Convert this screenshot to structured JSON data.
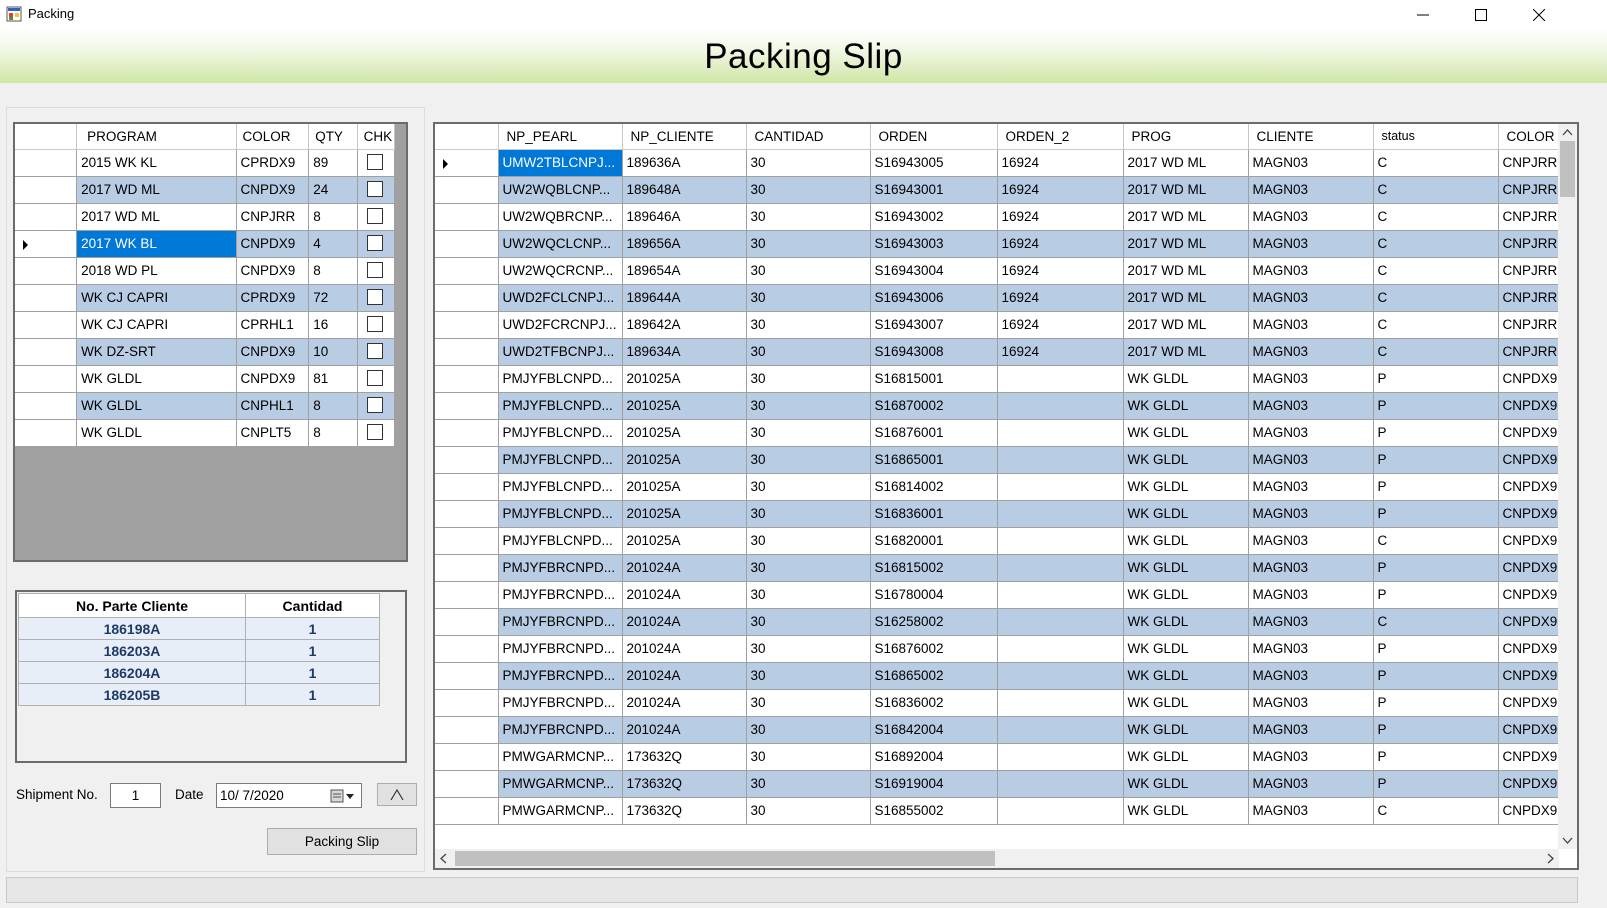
{
  "window": {
    "title": "Packing"
  },
  "banner": {
    "title": "Packing Slip"
  },
  "program_grid": {
    "columns": [
      "PROGRAM",
      "COLOR",
      "QTY",
      "CHK"
    ],
    "rows": [
      {
        "program": "2015 WK KL",
        "color": "CPRDX9",
        "qty": "89"
      },
      {
        "program": "2017 WD ML",
        "color": "CNPDX9",
        "qty": "24"
      },
      {
        "program": "2017 WD ML",
        "color": "CNPJRR",
        "qty": "8"
      },
      {
        "program": "2017 WK BL",
        "color": "CNPDX9",
        "qty": "4"
      },
      {
        "program": "2018 WD PL",
        "color": "CNPDX9",
        "qty": "8"
      },
      {
        "program": "WK CJ CAPRI",
        "color": "CPRDX9",
        "qty": "72"
      },
      {
        "program": "WK CJ CAPRI",
        "color": "CPRHL1",
        "qty": "16"
      },
      {
        "program": "WK DZ-SRT",
        "color": "CNPDX9",
        "qty": "10"
      },
      {
        "program": "WK GLDL",
        "color": "CNPDX9",
        "qty": "81"
      },
      {
        "program": "WK GLDL",
        "color": "CNPHL1",
        "qty": "8"
      },
      {
        "program": "WK GLDL",
        "color": "CNPLT5",
        "qty": "8"
      }
    ]
  },
  "parts_table": {
    "headers": [
      "No. Parte Cliente",
      "Cantidad"
    ],
    "rows": [
      {
        "part": "186198A",
        "qty": "1"
      },
      {
        "part": "186203A",
        "qty": "1"
      },
      {
        "part": "186204A",
        "qty": "1"
      },
      {
        "part": "186205B",
        "qty": "1"
      }
    ]
  },
  "shipment": {
    "label": "Shipment No.",
    "value": "1",
    "date_label": "Date",
    "date_value": "10/  7/2020",
    "up_button": "^",
    "packing_slip_button": "Packing Slip"
  },
  "orders_grid": {
    "columns": [
      "NP_PEARL",
      "NP_CLIENTE",
      "CANTIDAD",
      "ORDEN",
      "ORDEN_2",
      "PROG",
      "CLIENTE",
      "status",
      "COLOR"
    ],
    "rows": [
      [
        "UMW2TBLCNPJ...",
        "189636A",
        "30",
        "S16943005",
        "16924",
        "2017 WD ML",
        "MAGN03",
        "C",
        "CNPJRR"
      ],
      [
        "UW2WQBLCNP...",
        "189648A",
        "30",
        "S16943001",
        "16924",
        "2017 WD ML",
        "MAGN03",
        "C",
        "CNPJRR"
      ],
      [
        "UW2WQBRCNP...",
        "189646A",
        "30",
        "S16943002",
        "16924",
        "2017 WD ML",
        "MAGN03",
        "C",
        "CNPJRR"
      ],
      [
        "UW2WQCLCNP...",
        "189656A",
        "30",
        "S16943003",
        "16924",
        "2017 WD ML",
        "MAGN03",
        "C",
        "CNPJRR"
      ],
      [
        "UW2WQCRCNP...",
        "189654A",
        "30",
        "S16943004",
        "16924",
        "2017 WD ML",
        "MAGN03",
        "C",
        "CNPJRR"
      ],
      [
        "UWD2FCLCNPJ...",
        "189644A",
        "30",
        "S16943006",
        "16924",
        "2017 WD ML",
        "MAGN03",
        "C",
        "CNPJRR"
      ],
      [
        "UWD2FCRCNPJ...",
        "189642A",
        "30",
        "S16943007",
        "16924",
        "2017 WD ML",
        "MAGN03",
        "C",
        "CNPJRR"
      ],
      [
        "UWD2TFBCNPJ...",
        "189634A",
        "30",
        "S16943008",
        "16924",
        "2017 WD ML",
        "MAGN03",
        "C",
        "CNPJRR"
      ],
      [
        "PMJYFBLCNPD...",
        "201025A",
        "30",
        "S16815001",
        "",
        "WK GLDL",
        "MAGN03",
        "P",
        "CNPDX9"
      ],
      [
        "PMJYFBLCNPD...",
        "201025A",
        "30",
        "S16870002",
        "",
        "WK GLDL",
        "MAGN03",
        "P",
        "CNPDX9"
      ],
      [
        "PMJYFBLCNPD...",
        "201025A",
        "30",
        "S16876001",
        "",
        "WK GLDL",
        "MAGN03",
        "P",
        "CNPDX9"
      ],
      [
        "PMJYFBLCNPD...",
        "201025A",
        "30",
        "S16865001",
        "",
        "WK GLDL",
        "MAGN03",
        "P",
        "CNPDX9"
      ],
      [
        "PMJYFBLCNPD...",
        "201025A",
        "30",
        "S16814002",
        "",
        "WK GLDL",
        "MAGN03",
        "P",
        "CNPDX9"
      ],
      [
        "PMJYFBLCNPD...",
        "201025A",
        "30",
        "S16836001",
        "",
        "WK GLDL",
        "MAGN03",
        "P",
        "CNPDX9"
      ],
      [
        "PMJYFBLCNPD...",
        "201025A",
        "30",
        "S16820001",
        "",
        "WK GLDL",
        "MAGN03",
        "C",
        "CNPDX9"
      ],
      [
        "PMJYFBRCNPD...",
        "201024A",
        "30",
        "S16815002",
        "",
        "WK GLDL",
        "MAGN03",
        "P",
        "CNPDX9"
      ],
      [
        "PMJYFBRCNPD...",
        "201024A",
        "30",
        "S16780004",
        "",
        "WK GLDL",
        "MAGN03",
        "P",
        "CNPDX9"
      ],
      [
        "PMJYFBRCNPD...",
        "201024A",
        "30",
        "S16258002",
        "",
        "WK GLDL",
        "MAGN03",
        "C",
        "CNPDX9"
      ],
      [
        "PMJYFBRCNPD...",
        "201024A",
        "30",
        "S16876002",
        "",
        "WK GLDL",
        "MAGN03",
        "P",
        "CNPDX9"
      ],
      [
        "PMJYFBRCNPD...",
        "201024A",
        "30",
        "S16865002",
        "",
        "WK GLDL",
        "MAGN03",
        "P",
        "CNPDX9"
      ],
      [
        "PMJYFBRCNPD...",
        "201024A",
        "30",
        "S16836002",
        "",
        "WK GLDL",
        "MAGN03",
        "P",
        "CNPDX9"
      ],
      [
        "PMJYFBRCNPD...",
        "201024A",
        "30",
        "S16842004",
        "",
        "WK GLDL",
        "MAGN03",
        "P",
        "CNPDX9"
      ],
      [
        "PMWGARMCNP...",
        "173632Q",
        "30",
        "S16892004",
        "",
        "WK GLDL",
        "MAGN03",
        "P",
        "CNPDX9"
      ],
      [
        "PMWGARMCNP...",
        "173632Q",
        "30",
        "S16919004",
        "",
        "WK GLDL",
        "MAGN03",
        "P",
        "CNPDX9"
      ],
      [
        "PMWGARMCNP...",
        "173632Q",
        "30",
        "S16855002",
        "",
        "WK GLDL",
        "MAGN03",
        "C",
        "CNPDX9"
      ]
    ]
  }
}
